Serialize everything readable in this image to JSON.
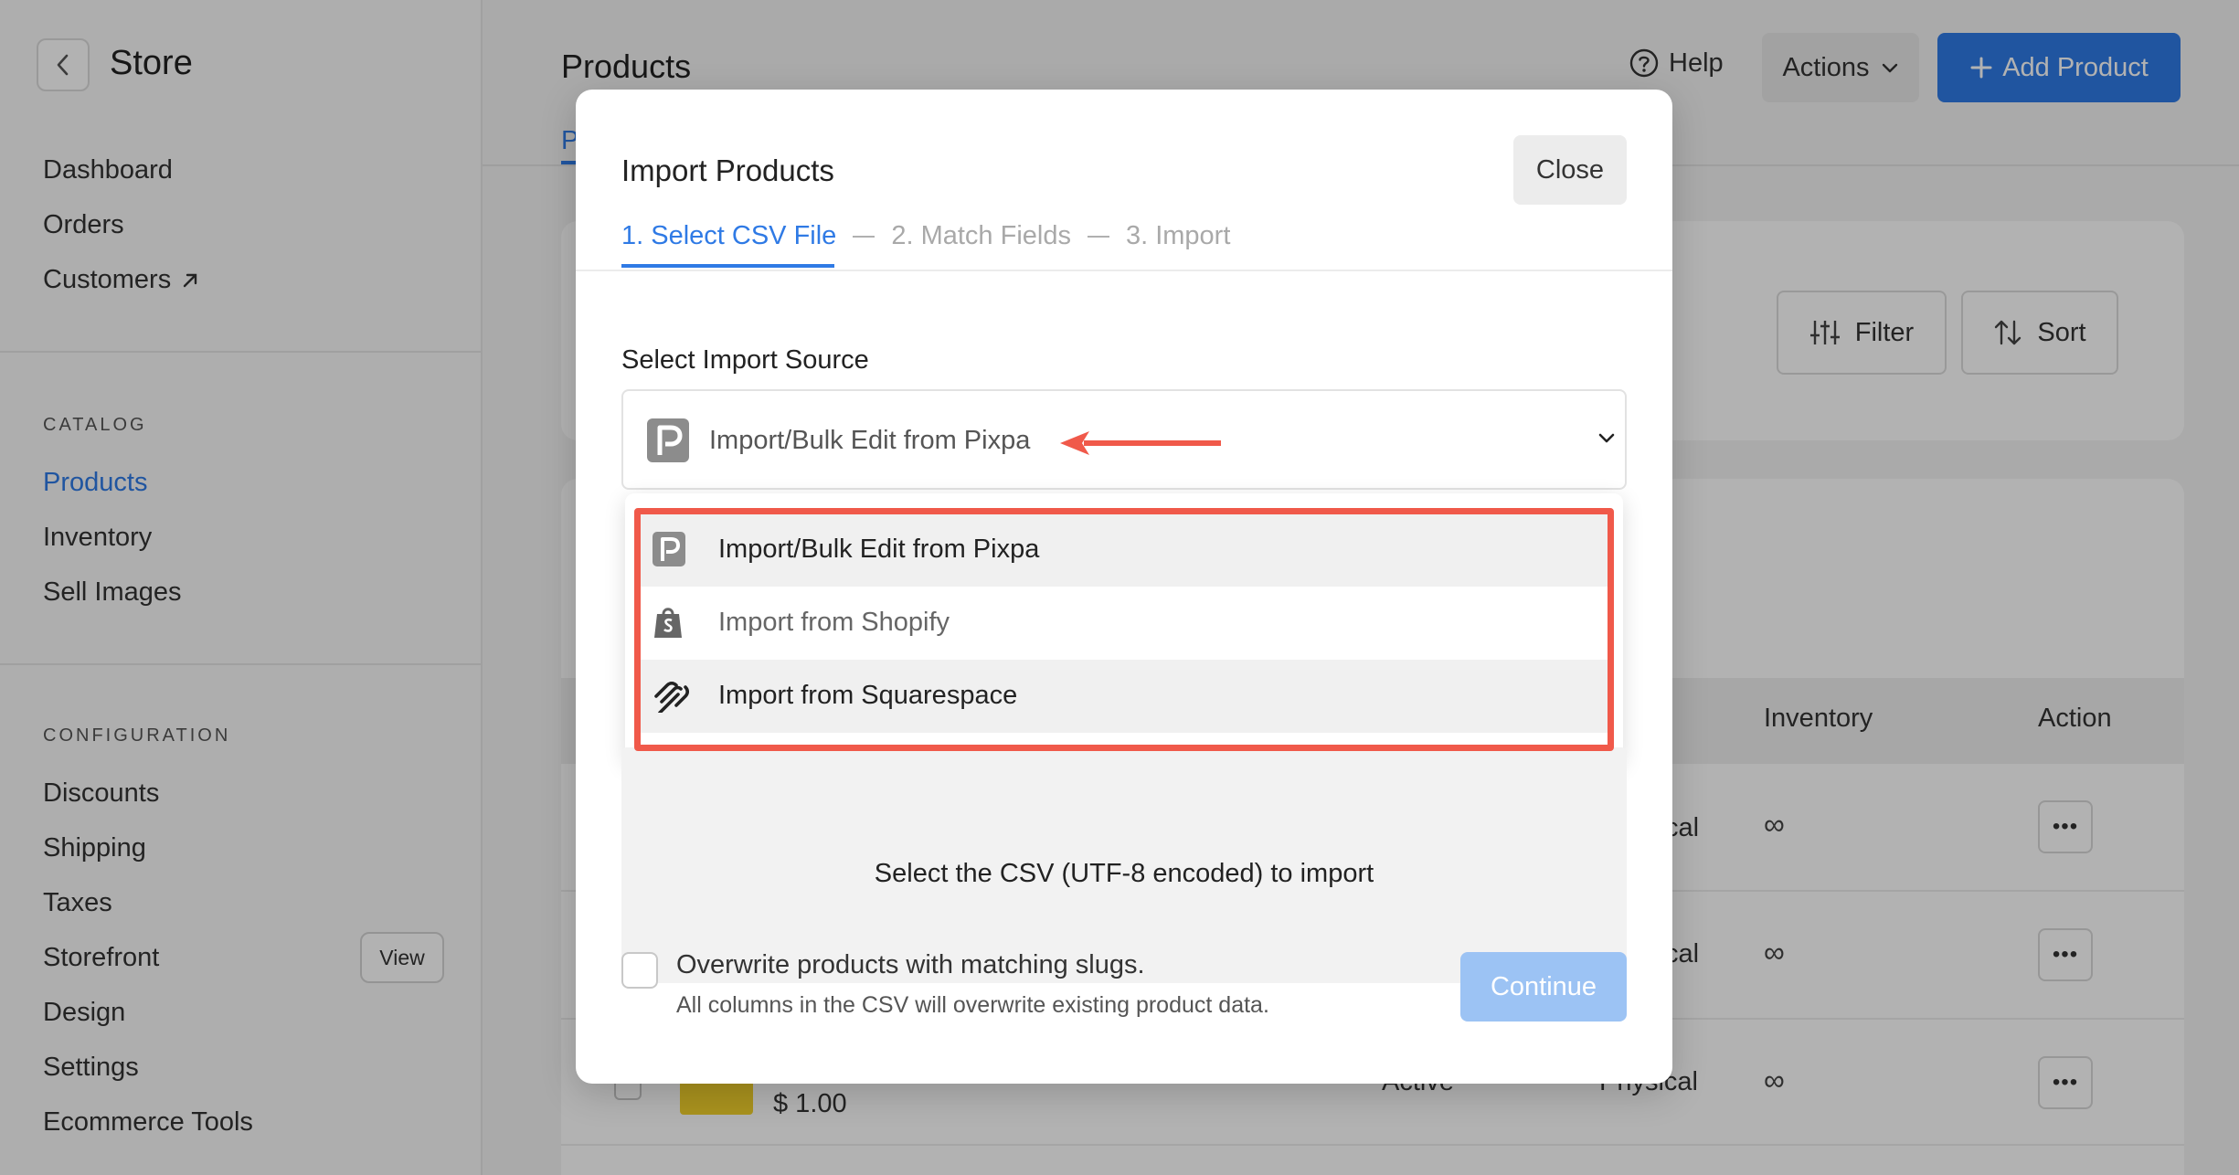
{
  "sidebar": {
    "store_title": "Store",
    "nav_top": [
      "Dashboard",
      "Orders",
      "Customers"
    ],
    "catalog_label": "CATALOG",
    "catalog_items": [
      "Products",
      "Inventory",
      "Sell Images"
    ],
    "config_label": "CONFIGURATION",
    "config_items": [
      "Discounts",
      "Shipping",
      "Taxes",
      "Storefront",
      "Design",
      "Settings",
      "Ecommerce Tools"
    ],
    "view_label": "View"
  },
  "header": {
    "page_title": "Products",
    "help_label": "Help",
    "actions_label": "Actions",
    "add_product_label": "Add Product",
    "tab_letter": "P"
  },
  "toolbar": {
    "filter_label": "Filter",
    "sort_label": "Sort"
  },
  "table": {
    "columns": [
      "Inventory",
      "Action"
    ],
    "rows": [
      {
        "type": "cal",
        "inventory": "∞"
      },
      {
        "type": "cal",
        "inventory": "∞"
      },
      {
        "status": "Active",
        "type": "Physical",
        "inventory": "∞",
        "price": "$ 1.00"
      }
    ]
  },
  "modal": {
    "title": "Import Products",
    "close_label": "Close",
    "steps": [
      "1. Select CSV File",
      "2. Match Fields",
      "3. Import"
    ],
    "source_label": "Select Import Source",
    "selected_source": "Import/Bulk Edit from Pixpa",
    "options": [
      {
        "label": "Import/Bulk Edit from Pixpa",
        "icon": "pixpa-icon"
      },
      {
        "label": "Import from Shopify",
        "icon": "shopify-icon"
      },
      {
        "label": "Import from Squarespace",
        "icon": "squarespace-icon"
      }
    ],
    "drop_text": "Select the CSV (UTF-8 encoded) to import",
    "overwrite_label": "Overwrite products with matching slugs.",
    "overwrite_desc": "All columns in the CSV will overwrite existing product data.",
    "continue_label": "Continue"
  },
  "colors": {
    "accent": "#2f7ae5",
    "highlight": "#f0594a",
    "continue_disabled": "#9cc3f4"
  }
}
